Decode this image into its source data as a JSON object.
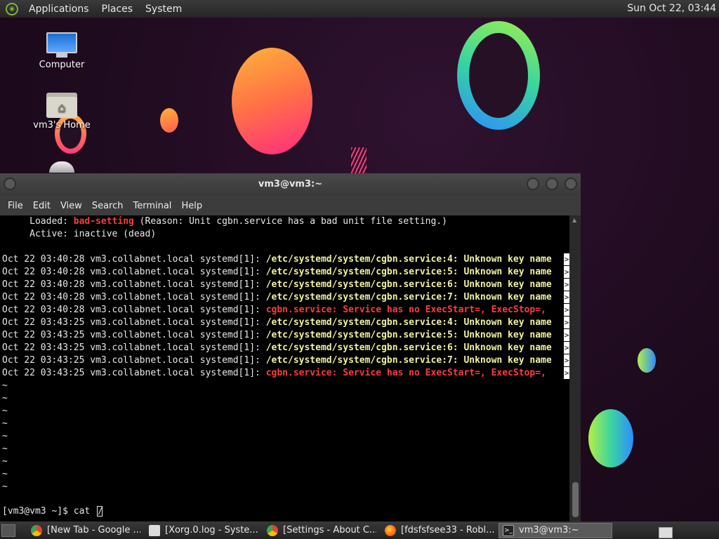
{
  "top_panel": {
    "menu": [
      "Applications",
      "Places",
      "System"
    ],
    "clock": "Sun Oct 22, 03:44"
  },
  "desktop_icons": [
    {
      "label": "Computer",
      "icon": "computer-icon"
    },
    {
      "label": "vm3's Home",
      "icon": "home-folder-icon"
    },
    {
      "label": "",
      "icon": "trash-icon"
    }
  ],
  "terminal": {
    "title": "vm3@vm3:~",
    "menu": [
      "File",
      "Edit",
      "View",
      "Search",
      "Terminal",
      "Help"
    ],
    "loaded_label": "     Loaded: ",
    "loaded_value": "bad-setting",
    "loaded_rest": " (Reason: Unit cgbn.service has a bad unit file setting.)",
    "active_line": "     Active: inactive (dead)",
    "log_lines": [
      {
        "prefix": "Oct 22 03:40:28 vm3.collabnet.local systemd[1]: ",
        "msg": "/etc/systemd/system/cgbn.service:4: Unknown key name",
        "level": "warn"
      },
      {
        "prefix": "Oct 22 03:40:28 vm3.collabnet.local systemd[1]: ",
        "msg": "/etc/systemd/system/cgbn.service:5: Unknown key name",
        "level": "warn"
      },
      {
        "prefix": "Oct 22 03:40:28 vm3.collabnet.local systemd[1]: ",
        "msg": "/etc/systemd/system/cgbn.service:6: Unknown key name",
        "level": "warn"
      },
      {
        "prefix": "Oct 22 03:40:28 vm3.collabnet.local systemd[1]: ",
        "msg": "/etc/systemd/system/cgbn.service:7: Unknown key name",
        "level": "warn"
      },
      {
        "prefix": "Oct 22 03:40:28 vm3.collabnet.local systemd[1]: ",
        "msg": "cgbn.service: Service has no ExecStart=, ExecStop=, ",
        "level": "error"
      },
      {
        "prefix": "Oct 22 03:43:25 vm3.collabnet.local systemd[1]: ",
        "msg": "/etc/systemd/system/cgbn.service:4: Unknown key name",
        "level": "warn"
      },
      {
        "prefix": "Oct 22 03:43:25 vm3.collabnet.local systemd[1]: ",
        "msg": "/etc/systemd/system/cgbn.service:5: Unknown key name",
        "level": "warn"
      },
      {
        "prefix": "Oct 22 03:43:25 vm3.collabnet.local systemd[1]: ",
        "msg": "/etc/systemd/system/cgbn.service:6: Unknown key name",
        "level": "warn"
      },
      {
        "prefix": "Oct 22 03:43:25 vm3.collabnet.local systemd[1]: ",
        "msg": "/etc/systemd/system/cgbn.service:7: Unknown key name",
        "level": "warn"
      },
      {
        "prefix": "Oct 22 03:43:25 vm3.collabnet.local systemd[1]: ",
        "msg": "cgbn.service: Service has no ExecStart=, ExecStop=, ",
        "level": "error"
      }
    ],
    "overflow_marker": ">",
    "tilde_lines": [
      "~",
      "~",
      "~",
      "~",
      "~",
      "~",
      "~",
      "~",
      "~"
    ],
    "prompt": "[vm3@vm3 ~]$ cat ",
    "typed_input": "/"
  },
  "taskbar": {
    "tasks": [
      {
        "label": "[New Tab - Google ...",
        "icon": "chrome-icon",
        "active": false
      },
      {
        "label": "[Xorg.0.log - Syste...",
        "icon": "document-icon",
        "active": false
      },
      {
        "label": "[Settings - About C...",
        "icon": "chrome-icon",
        "active": false
      },
      {
        "label": "[fdsfsfsee33 - Robl...",
        "icon": "firefox-icon",
        "active": false
      },
      {
        "label": "vm3@vm3:~",
        "icon": "terminal-icon",
        "active": true
      }
    ]
  }
}
